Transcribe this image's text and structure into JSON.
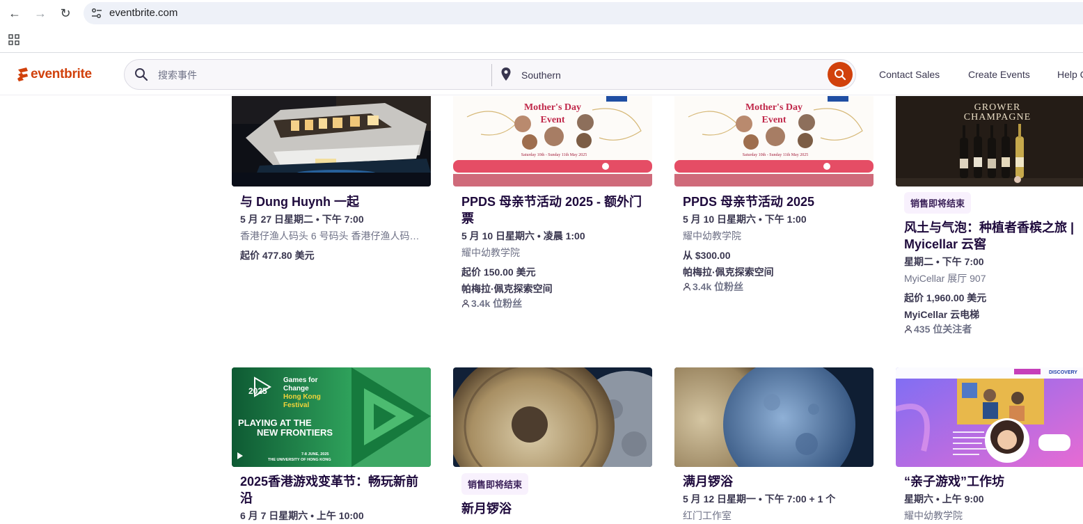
{
  "browser": {
    "url": "eventbrite.com"
  },
  "header": {
    "logo_text": "eventbrite",
    "search_placeholder": "搜索事件",
    "location_value": "Southern",
    "links": [
      "Contact Sales",
      "Create Events",
      "Help C"
    ]
  },
  "cards": [
    {
      "title": "与 Dung Huynh 一起",
      "date": "5 月 27 日星期二 • 下午 7:00",
      "venue": "香港仔渔人码头 6 号码头 香港仔渔人码头…",
      "price": "起价 477.80 美元"
    },
    {
      "title": "PPDS 母亲节活动 2025 - 额外门票",
      "date": "5 月 10 日星期六 • 凌晨 1:00",
      "venue": "耀中幼教学院",
      "price": "起价 150.00 美元",
      "organizer": "帕梅拉·佩克探索空间",
      "followers": "3.4k 位粉丝",
      "image": {
        "header": "Mother's Day Event",
        "dates": "Saturday 10th - Sunday 11th May 2025"
      }
    },
    {
      "title": "PPDS 母亲节活动 2025",
      "date": "5 月 10 日星期六 • 下午 1:00",
      "venue": "耀中幼教学院",
      "price": "从 $300.00",
      "organizer": "帕梅拉·佩克探索空间",
      "followers": "3.4k 位粉丝",
      "image": {
        "header": "Mother's Day Event",
        "dates": "Saturday 10th - Sunday 11th May 2025"
      }
    },
    {
      "badge": "销售即将结束",
      "title": "风土与气泡：种植者香槟之旅 | Myicellar 云窖",
      "date": "星期二 • 下午 7:00",
      "venue": "MyiCellar 展厅 907",
      "price": "起价 1,960.00 美元",
      "organizer": "MyiCellar 云电梯",
      "followers": "435 位关注者",
      "image": {
        "header": "GROWER CHAMPAGNE"
      }
    },
    {
      "title": "2025香港游戏变革节：畅玩新前沿",
      "date": "6 月 7 日星期六 • 上午 10:00",
      "image": {
        "year": "2025",
        "brand_line1": "Games for",
        "brand_line2": "Change",
        "brand_line3": "Hong Kong",
        "brand_line4": "Festival",
        "tagline": "PLAYING AT THE NEW FRONTIERS",
        "event_dates": "7-8 JUNE, 2025",
        "venue": "THE UNIVERSITY OF HONG KONG"
      }
    },
    {
      "badge": "销售即将结束",
      "title": "新月锣浴"
    },
    {
      "title": "满月锣浴",
      "date": "5 月 12 日星期一 • 下午 7:00 + 1 个",
      "venue": "红门工作室"
    },
    {
      "title": "“亲子游戏”工作坊",
      "date": "星期六 • 上午 9:00",
      "venue": "耀中幼教学院",
      "image": {
        "brand": "DISCOVERY"
      }
    }
  ],
  "colors": {
    "brand": "#d1410c",
    "text_dark": "#1e0a3c",
    "text_muted": "#6f7287",
    "badge_bg": "#f8f1fd"
  }
}
